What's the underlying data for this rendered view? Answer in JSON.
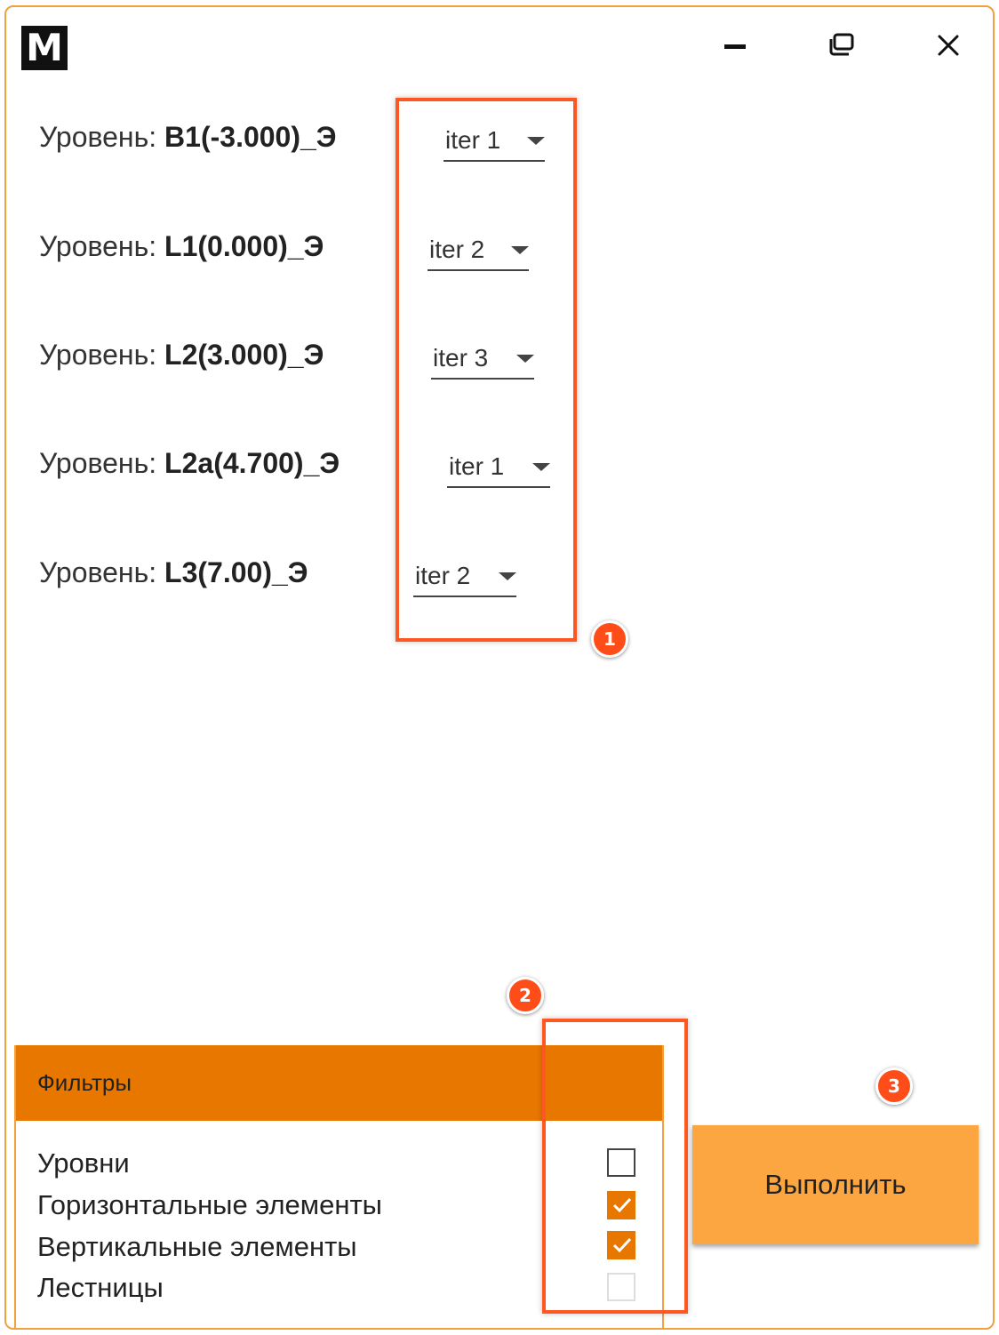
{
  "window": {
    "logo": "M",
    "controls": [
      "minimize",
      "maximize",
      "close"
    ]
  },
  "levels": [
    {
      "prefix": "Уровень:",
      "name": "B1(-3.000)_Э",
      "iteration": "iter 1"
    },
    {
      "prefix": "Уровень:",
      "name": "L1(0.000)_Э",
      "iteration": "iter 2"
    },
    {
      "prefix": "Уровень:",
      "name": "L2(3.000)_Э",
      "iteration": "iter 3"
    },
    {
      "prefix": "Уровень:",
      "name": "L2a(4.700)_Э",
      "iteration": "iter 1"
    },
    {
      "prefix": "Уровень:",
      "name": "L3(7.00)_Э",
      "iteration": "iter 2"
    }
  ],
  "filters": {
    "title": "Фильтры",
    "items": [
      {
        "label": "Уровни",
        "checked": false
      },
      {
        "label": "Горизонтальные элементы",
        "checked": true
      },
      {
        "label": "Вертикальные элементы",
        "checked": true
      },
      {
        "label": "Лестницы",
        "checked": false
      }
    ]
  },
  "actions": {
    "run_label": "Выполнить"
  },
  "annotations": {
    "markers": [
      "1",
      "2",
      "3"
    ],
    "callout_color": "#ff5722"
  },
  "colors": {
    "accent": "#e87700",
    "button": "#fca641",
    "border": "#f0a040"
  }
}
